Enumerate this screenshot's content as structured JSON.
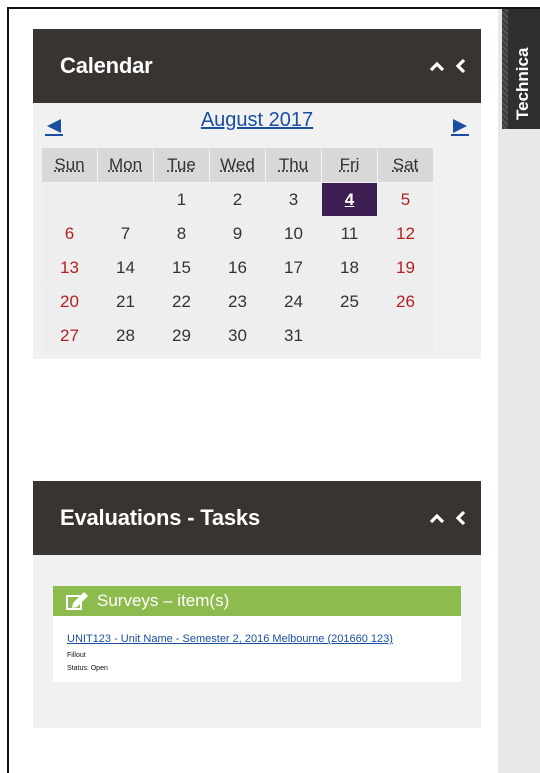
{
  "side_tab": {
    "label": "Technica"
  },
  "calendar": {
    "title": "Calendar",
    "month": "August 2017",
    "days": [
      "Sun",
      "Mon",
      "Tue",
      "Wed",
      "Thu",
      "Fri",
      "Sat"
    ],
    "weeks": [
      [
        "",
        "",
        "1",
        "2",
        "3",
        "4",
        "5"
      ],
      [
        "6",
        "7",
        "8",
        "9",
        "10",
        "11",
        "12"
      ],
      [
        "13",
        "14",
        "15",
        "16",
        "17",
        "18",
        "19"
      ],
      [
        "20",
        "21",
        "22",
        "23",
        "24",
        "25",
        "26"
      ],
      [
        "27",
        "28",
        "29",
        "30",
        "31",
        "",
        ""
      ]
    ],
    "today": "4"
  },
  "evaluations": {
    "title": "Evaluations - Tasks",
    "surveys_label": "Surveys  –  item(s)",
    "survey_link": "UNIT123 - Unit Name - Semester 2, 2016 Melbourne (201660 123)",
    "fill_label": "Fillout",
    "status_label": "Status: Open"
  },
  "colors": {
    "header_bg": "#3a3430",
    "today_bg": "#3e1f53",
    "weekend_text": "#b22222",
    "link_blue": "#1a4fa0",
    "surveys_green": "#8dbb4e"
  }
}
